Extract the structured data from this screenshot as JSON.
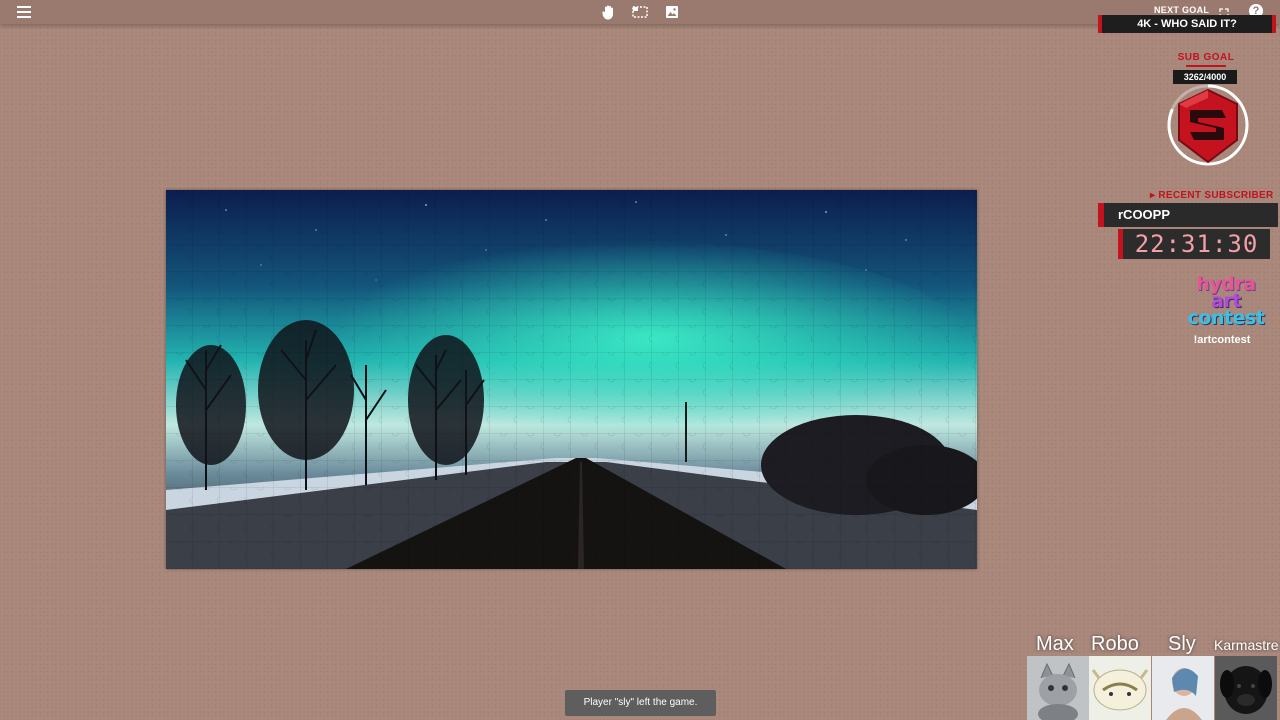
{
  "toolbar": {
    "menu_icon": "hamburger-menu-icon",
    "tools": [
      {
        "icon": "hand-icon"
      },
      {
        "icon": "box-select-icon"
      },
      {
        "icon": "image-preview-icon"
      }
    ],
    "help_label": "?"
  },
  "overlay": {
    "next_goal_label": "NEXT GOAL",
    "next_goal_text": "4K - WHO SAID IT?",
    "sub_goal_label": "SUB GOAL",
    "sub_goal_count": "3262/4000",
    "sub_goal_progress": 0.8155,
    "recent_subscriber_label": "▸ RECENT SUBSCRIBER",
    "recent_subscriber_name": "rCOOPP",
    "clock": "22:31:30",
    "contest": {
      "line1": "hydra",
      "line2": "art",
      "line3": "contest",
      "command": "!artcontest"
    },
    "accent_color": "#c4121f"
  },
  "players": [
    {
      "name": "Max",
      "avatar": "cat-avatar"
    },
    {
      "name": "Robo",
      "avatar": "sky-bison-avatar"
    },
    {
      "name": "Sly",
      "avatar": "woman-portrait-avatar"
    },
    {
      "name": "Karmastre",
      "avatar": "black-dog-avatar"
    }
  ],
  "toast": "Player \"sly\" left the game.",
  "puzzle": {
    "image": "aurora-over-snowy-road",
    "colors": {
      "sky_top": "#0c1e4e",
      "aurora": "#2fe0c0",
      "ground": "#1a1614"
    }
  }
}
